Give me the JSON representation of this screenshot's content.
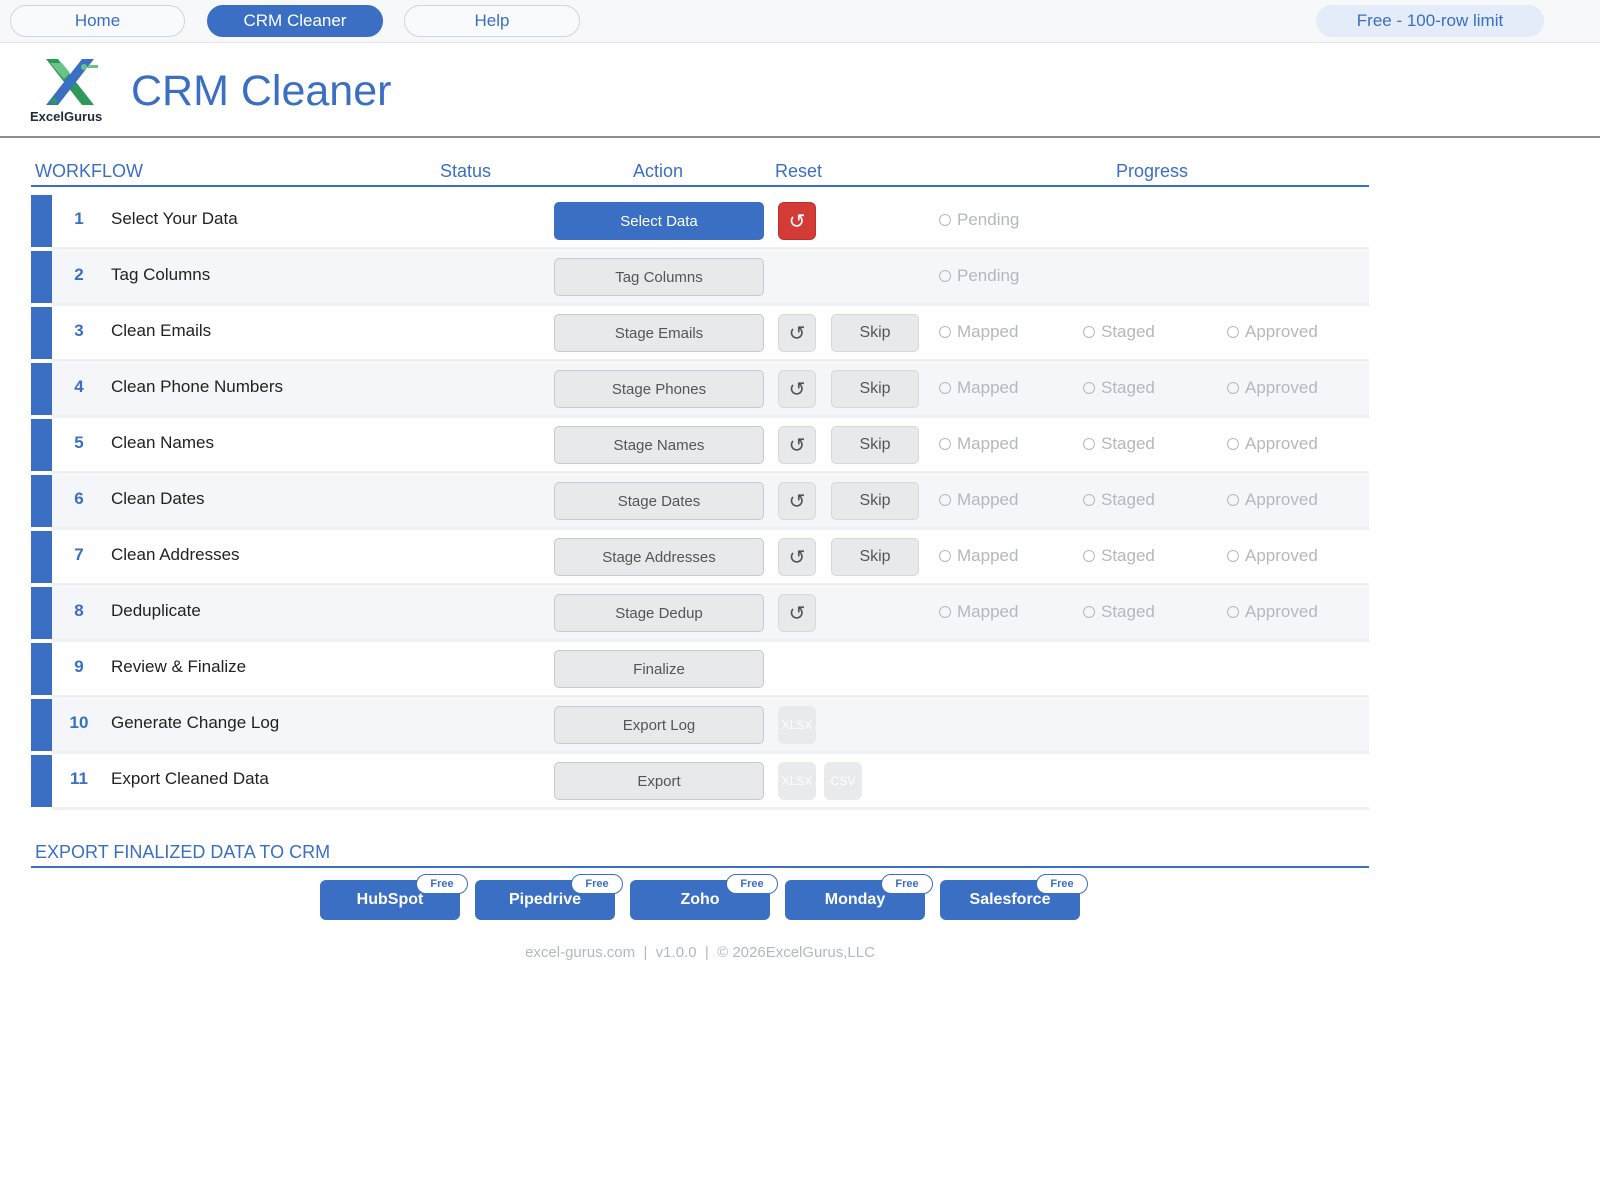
{
  "nav": {
    "items": [
      "Home",
      "CRM Cleaner",
      "Help"
    ],
    "plan": "Free - 100-row limit"
  },
  "header": {
    "logo_text": "ExcelGurus",
    "title": "CRM Cleaner"
  },
  "workflow": {
    "heading": "WORKFLOW",
    "col_status": "Status",
    "col_action": "Action",
    "col_reset": "Reset",
    "col_progress": "Progress",
    "skip_label": "Skip",
    "reset_glyph": "↺",
    "progress_labels": {
      "pending": "Pending",
      "mapped": "Mapped",
      "staged": "Staged",
      "approved": "Approved"
    },
    "formats": {
      "xlsx": "XLSX",
      "csv": "CSV"
    },
    "steps": [
      {
        "num": "1",
        "label": "Select Your Data",
        "action": "Select Data"
      },
      {
        "num": "2",
        "label": "Tag Columns",
        "action": "Tag Columns"
      },
      {
        "num": "3",
        "label": "Clean Emails",
        "action": "Stage Emails"
      },
      {
        "num": "4",
        "label": "Clean Phone Numbers",
        "action": "Stage Phones"
      },
      {
        "num": "5",
        "label": "Clean Names",
        "action": "Stage Names"
      },
      {
        "num": "6",
        "label": "Clean Dates",
        "action": "Stage Dates"
      },
      {
        "num": "7",
        "label": "Clean Addresses",
        "action": "Stage Addresses"
      },
      {
        "num": "8",
        "label": "Deduplicate",
        "action": "Stage Dedup"
      },
      {
        "num": "9",
        "label": "Review & Finalize",
        "action": "Finalize"
      },
      {
        "num": "10",
        "label": "Generate Change Log",
        "action": "Export Log"
      },
      {
        "num": "11",
        "label": "Export Cleaned Data",
        "action": "Export"
      }
    ]
  },
  "export": {
    "heading": "EXPORT FINALIZED DATA TO CRM",
    "badge": "Free",
    "crms": [
      "HubSpot",
      "Pipedrive",
      "Zoho",
      "Monday",
      "Salesforce"
    ]
  },
  "footer": "excel-gurus.com  |  v1.0.0  |  © 2026ExcelGurus,LLC",
  "colors": {
    "accent": "#3a6fc4",
    "danger": "#d23b36",
    "muted": "#b4b8be"
  }
}
